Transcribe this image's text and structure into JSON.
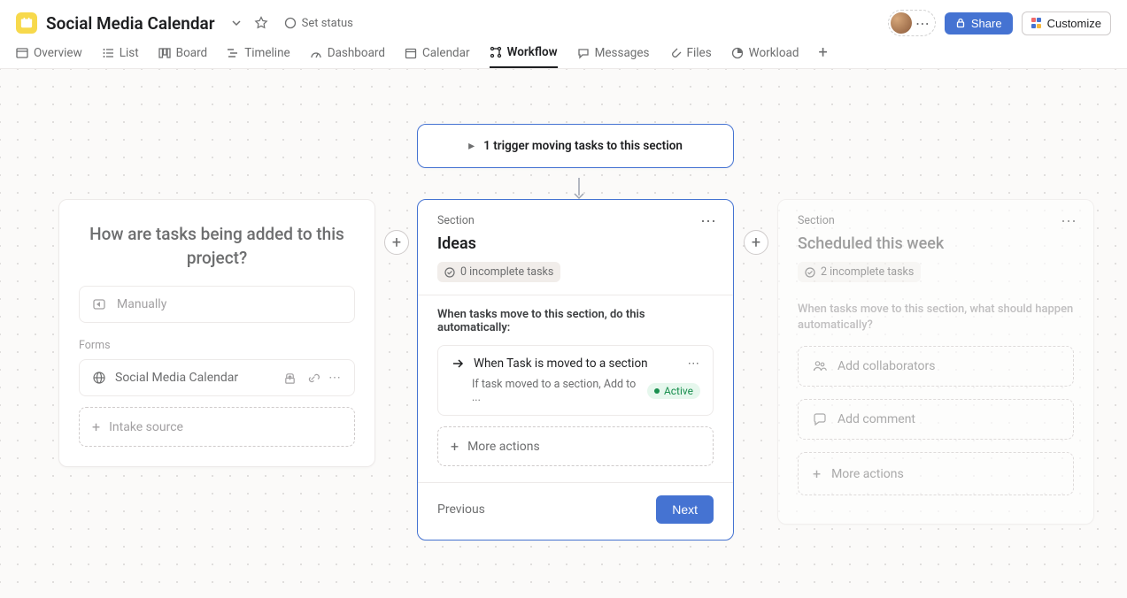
{
  "header": {
    "title": "Social Media Calendar",
    "set_status": "Set status",
    "share": "Share",
    "customize": "Customize"
  },
  "tabs": {
    "overview": "Overview",
    "list": "List",
    "board": "Board",
    "timeline": "Timeline",
    "dashboard": "Dashboard",
    "calendar": "Calendar",
    "workflow": "Workflow",
    "messages": "Messages",
    "files": "Files",
    "workload": "Workload"
  },
  "intake": {
    "title": "How are tasks being added to this project?",
    "manual": "Manually",
    "forms_label": "Forms",
    "form_name": "Social Media Calendar",
    "add_source": "Intake source"
  },
  "trigger": {
    "text": "1 trigger moving tasks to this section"
  },
  "section_ideas": {
    "section_label": "Section",
    "title": "Ideas",
    "badge": "0 incomplete tasks",
    "body_heading": "When tasks move to this section, do this automatically:",
    "rule_title": "When Task is moved to a section",
    "rule_desc": "If task moved to a section, Add to ...",
    "rule_status": "Active",
    "more_actions": "More actions",
    "previous": "Previous",
    "next": "Next"
  },
  "section_scheduled": {
    "section_label": "Section",
    "title": "Scheduled this week",
    "badge": "2 incomplete tasks",
    "body_heading": "When tasks move to this section, what should happen automatically?",
    "add_collab": "Add collaborators",
    "add_comment": "Add comment",
    "more_actions": "More actions"
  }
}
